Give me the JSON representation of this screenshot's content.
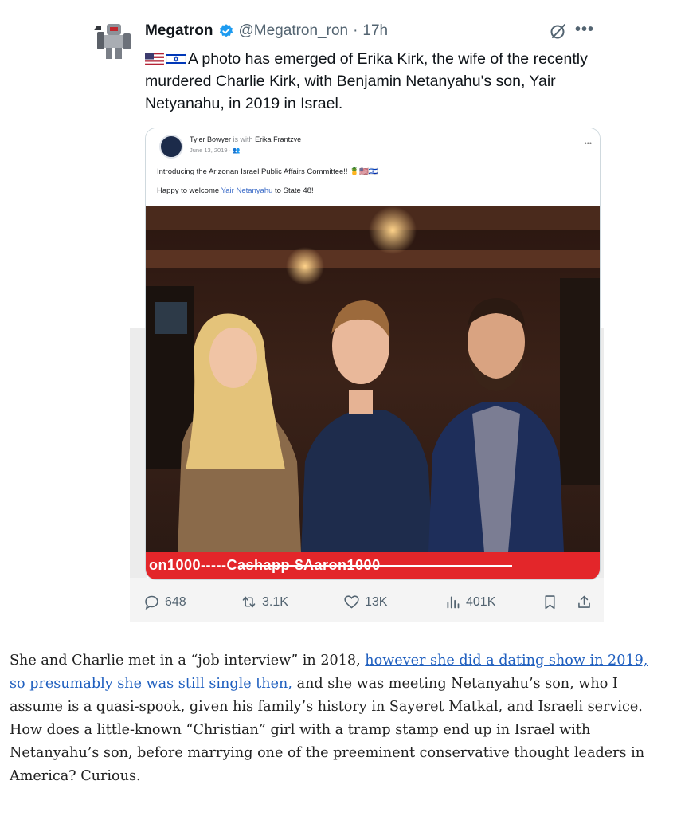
{
  "tweet": {
    "display_name": "Megatron",
    "handle": "@Megatron_ron",
    "separator": "·",
    "time": "17h",
    "flags": [
      "us-flag",
      "israel-flag"
    ],
    "text": "A photo has emerged of Erika Kirk, the wife of the recently murdered Charlie Kirk, with Benjamin Netanyahu's son, Yair Netyanahu, in 2019 in Israel.",
    "media": {
      "fb_author": "Tyler Bowyer",
      "fb_with": "is with",
      "fb_tagged": "Erika Frantzve",
      "fb_date": "June 13, 2019 · 👥",
      "fb_line1": "Introducing the Arizonan Israel Public Affairs Committee!! 🍍🇺🇸🇮🇱",
      "fb_line2_prefix": "Happy to welcome ",
      "fb_line2_link": "Yair Netanyahu",
      "fb_line2_suffix": " to State 48!",
      "overlay_text": "on1000-----Cashapp-$Aaron1000"
    },
    "stats": {
      "replies": "648",
      "reposts": "3.1K",
      "likes": "13K",
      "views": "401K"
    }
  },
  "article": {
    "p1_start": "She and Charlie met in a “job interview” in 2018, ",
    "p1_link": "however she did a dating show in 2019, so presumably she was still single then,",
    "p1_end": " and she was meeting Netanyahu’s son, who I assume is a quasi-spook, given his family’s history in Sayeret Matkal, and Israeli service. How does a little-known “Christian” girl with a tramp stamp end up in Israel with Netanyahu’s son, before marrying one of the preeminent conservative thought leaders in America? Curious."
  },
  "colors": {
    "verified": "#1d9bf0",
    "text": "#0f1419",
    "muted": "#536471",
    "link": "#1f5fbf",
    "overlay_red": "#e3262a"
  }
}
